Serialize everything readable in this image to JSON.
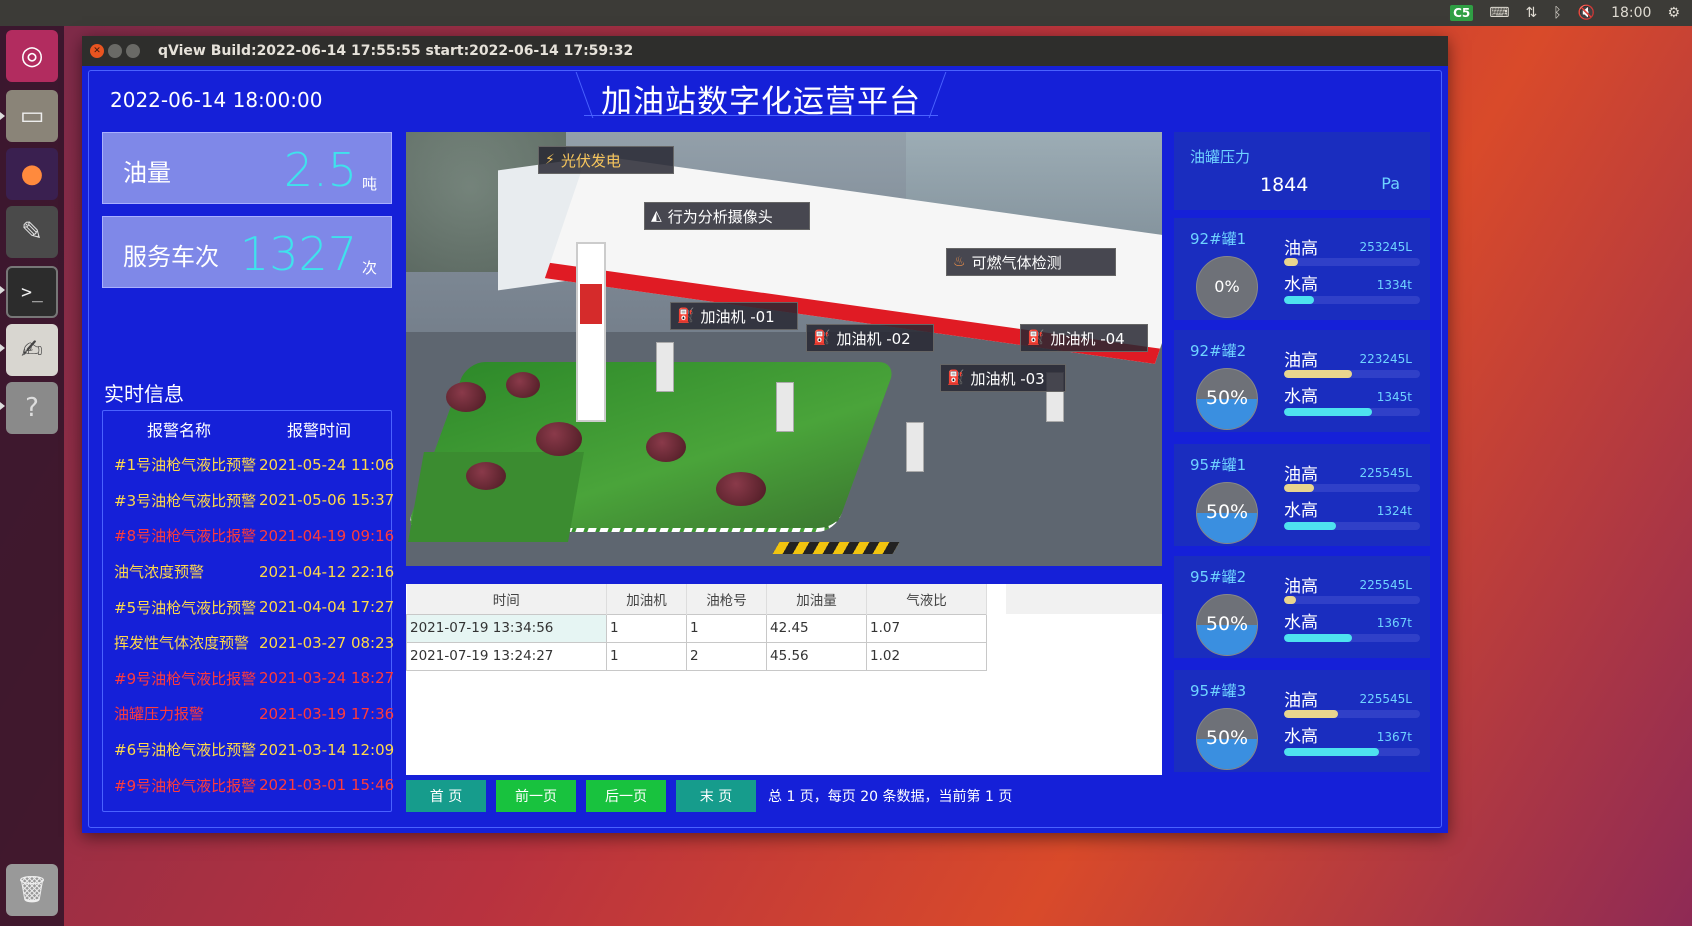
{
  "os_topbar": {
    "app_badge": "C5",
    "clock": "18:00"
  },
  "window": {
    "title": "qView Build:2022-06-14 17:55:55 start:2022-06-14 17:59:32"
  },
  "app": {
    "datetime": "2022-06-14 18:00:00",
    "title": "加油站数字化运营平台"
  },
  "stats": {
    "fuel": {
      "label": "油量",
      "value": "2.5",
      "unit": "吨"
    },
    "service": {
      "label": "服务车次",
      "value": "1327",
      "unit": "次"
    }
  },
  "realtime": {
    "title": "实时信息",
    "col_name": "报警名称",
    "col_time": "报警时间",
    "rows": [
      {
        "name": "#1号油枪气液比预警",
        "time": "2021-05-24 11:06",
        "level": "warn"
      },
      {
        "name": "#3号油枪气液比预警",
        "time": "2021-05-06 15:37",
        "level": "warn"
      },
      {
        "name": "#8号油枪气液比报警",
        "time": "2021-04-19 09:16",
        "level": "alert"
      },
      {
        "name": "油气浓度预警",
        "time": "2021-04-12 22:16",
        "level": "warn"
      },
      {
        "name": "#5号油枪气液比预警",
        "time": "2021-04-04 17:27",
        "level": "warn"
      },
      {
        "name": "挥发性气体浓度预警",
        "time": "2021-03-27 08:23",
        "level": "warn"
      },
      {
        "name": "#9号油枪气液比报警",
        "time": "2021-03-24 18:27",
        "level": "alert"
      },
      {
        "name": "油罐压力报警",
        "time": "2021-03-19 17:36",
        "level": "alert"
      },
      {
        "name": "#6号油枪气液比预警",
        "time": "2021-03-14 12:09",
        "level": "warn"
      },
      {
        "name": "#9号油枪气液比报警",
        "time": "2021-03-01 15:46",
        "level": "alert"
      }
    ]
  },
  "scene": {
    "tags": {
      "solar": "光伏发电",
      "camera": "行为分析摄像头",
      "gas_detect": "可燃气体检测",
      "pump1": "加油机 -01",
      "pump2": "加油机 -02",
      "pump3": "加油机 -03",
      "pump4": "加油机 -04"
    }
  },
  "records": {
    "headers": [
      "时间",
      "加油机",
      "油枪号",
      "加油量",
      "气液比"
    ],
    "rows": [
      [
        "2021-07-19 13:34:56",
        "1",
        "1",
        "42.45",
        "1.07"
      ],
      [
        "2021-07-19 13:24:27",
        "1",
        "2",
        "45.56",
        "1.02"
      ]
    ]
  },
  "pager": {
    "first": "首 页",
    "prev": "前一页",
    "next": "后一页",
    "last": "末 页",
    "info": "总 1 页，每页 20 条数据，当前第 1 页"
  },
  "pressure": {
    "label": "油罐压力",
    "value": "1844",
    "unit": "Pa"
  },
  "tanks": [
    {
      "name": "92#罐1",
      "percent": "0%",
      "level": 0.0,
      "oil_label": "油高",
      "oil_value": "253245L",
      "oil_fill": 0.1,
      "water_label": "水高",
      "water_value": "1334t",
      "water_fill": 0.22
    },
    {
      "name": "92#罐2",
      "percent": "50%",
      "level": 0.5,
      "oil_label": "油高",
      "oil_value": "223245L",
      "oil_fill": 0.5,
      "water_label": "水高",
      "water_value": "1345t",
      "water_fill": 0.65
    },
    {
      "name": "95#罐1",
      "percent": "50%",
      "level": 0.5,
      "oil_label": "油高",
      "oil_value": "225545L",
      "oil_fill": 0.22,
      "water_label": "水高",
      "water_value": "1324t",
      "water_fill": 0.38
    },
    {
      "name": "95#罐2",
      "percent": "50%",
      "level": 0.5,
      "oil_label": "油高",
      "oil_value": "225545L",
      "oil_fill": 0.09,
      "water_label": "水高",
      "water_value": "1367t",
      "water_fill": 0.5
    },
    {
      "name": "95#罐3",
      "percent": "50%",
      "level": 0.5,
      "oil_label": "油高",
      "oil_value": "225545L",
      "oil_fill": 0.4,
      "water_label": "水高",
      "water_value": "1367t",
      "water_fill": 0.7
    }
  ]
}
